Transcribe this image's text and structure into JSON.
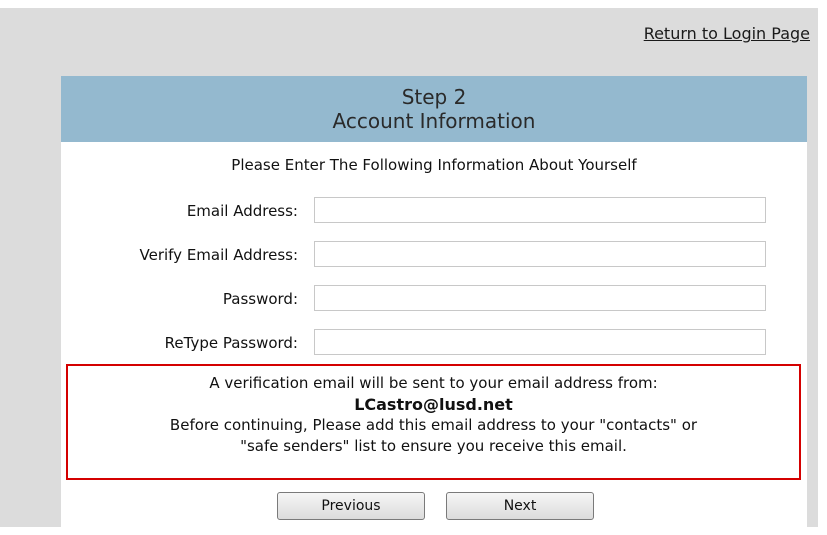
{
  "header_link": {
    "return_login": "Return to Login Page"
  },
  "panel": {
    "step": "Step 2",
    "title": "Account Information",
    "intro": "Please Enter The Following Information About Yourself"
  },
  "fields": {
    "email": {
      "label": "Email Address:",
      "value": ""
    },
    "verify_email": {
      "label": "Verify Email Address:",
      "value": ""
    },
    "password": {
      "label": "Password:",
      "value": ""
    },
    "retype_password": {
      "label": "ReType Password:",
      "value": ""
    }
  },
  "notice": {
    "line1": "A verification email will be sent to your email address from:",
    "sender": "LCastro@lusd.net",
    "line3": "Before continuing, Please add this email address to your \"contacts\" or",
    "line4": "\"safe senders\" list to ensure you receive this email."
  },
  "buttons": {
    "previous": "Previous",
    "next": "Next"
  },
  "colors": {
    "header_bg": "#94b9cf",
    "notice_border": "#d40000",
    "page_bg": "#dcdcdc"
  }
}
